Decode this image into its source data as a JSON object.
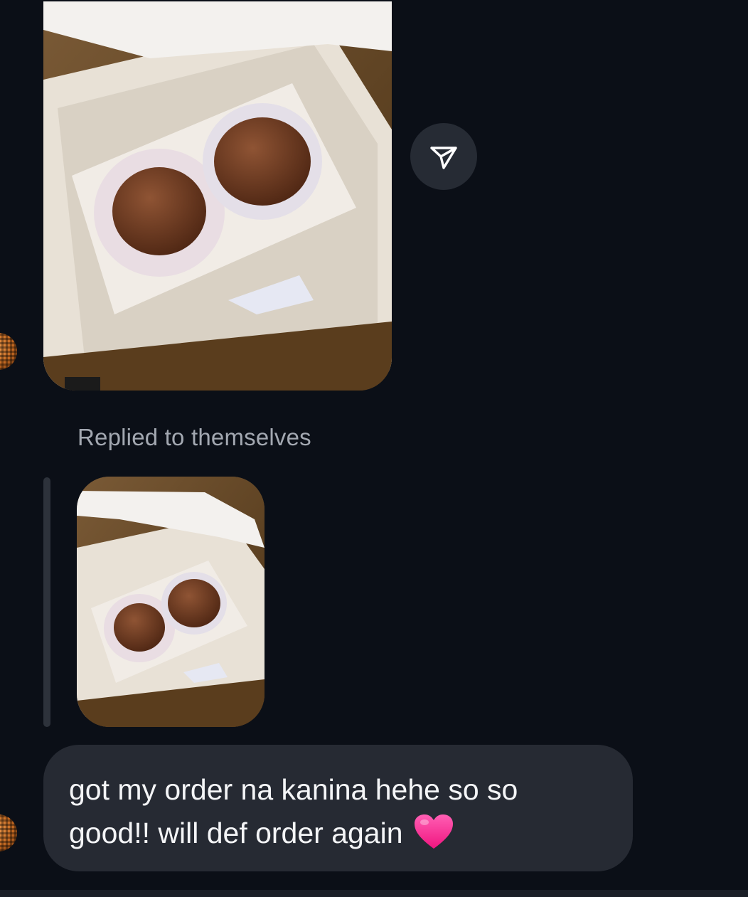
{
  "conversation": {
    "messages": [
      {
        "type": "photo",
        "sender": "other",
        "image": "chocolate-truffles-in-white-box-photo"
      },
      {
        "type": "photo-reply",
        "sender": "other",
        "reply_label": "Replied to themselves",
        "image": "chocolate-truffles-in-white-box-thumbnail"
      },
      {
        "type": "text",
        "sender": "other",
        "text": "got my order na kanina hehe so so good!! will def order again",
        "emoji": "pink-heart"
      }
    ],
    "actions": {
      "share_icon": "send-paper-plane-icon"
    }
  },
  "colors": {
    "background": "#0b0f17",
    "bubble": "#262a33",
    "share_button": "#262b34",
    "secondary_text": "#a3a8b1",
    "primary_text": "#f4f5f7",
    "heart": "#ff2d95"
  }
}
